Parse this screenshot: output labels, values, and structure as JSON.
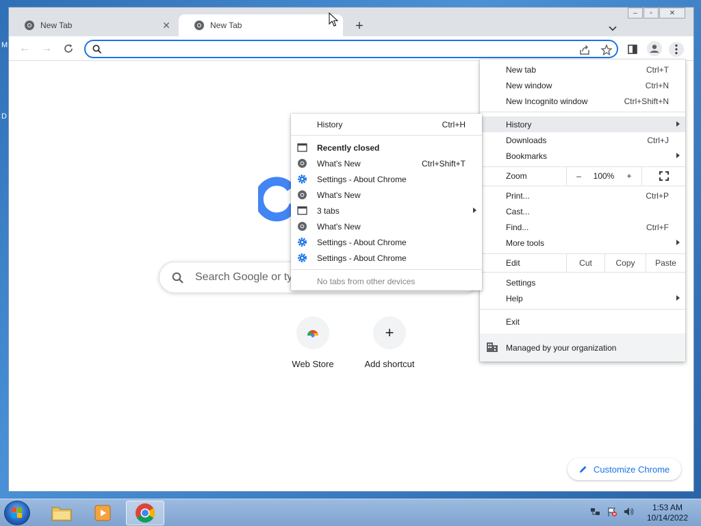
{
  "desktop": {
    "left_letters": [
      "M",
      "D"
    ]
  },
  "tabs": [
    {
      "title": "New Tab",
      "active": false
    },
    {
      "title": "New Tab",
      "active": true
    }
  ],
  "omnibox": {
    "value": "",
    "placeholder": ""
  },
  "ntp": {
    "search_placeholder": "Search Google or ty",
    "shortcuts": [
      {
        "label": "Web Store"
      },
      {
        "label": "Add shortcut"
      }
    ],
    "customize_label": "Customize Chrome"
  },
  "main_menu": {
    "new_tab": {
      "label": "New tab",
      "shortcut": "Ctrl+T"
    },
    "new_window": {
      "label": "New window",
      "shortcut": "Ctrl+N"
    },
    "new_incognito": {
      "label": "New Incognito window",
      "shortcut": "Ctrl+Shift+N"
    },
    "history": {
      "label": "History"
    },
    "downloads": {
      "label": "Downloads",
      "shortcut": "Ctrl+J"
    },
    "bookmarks": {
      "label": "Bookmarks"
    },
    "zoom": {
      "label": "Zoom",
      "minus": "–",
      "level": "100%",
      "plus": "+"
    },
    "print": {
      "label": "Print...",
      "shortcut": "Ctrl+P"
    },
    "cast": {
      "label": "Cast..."
    },
    "find": {
      "label": "Find...",
      "shortcut": "Ctrl+F"
    },
    "more_tools": {
      "label": "More tools"
    },
    "edit": {
      "label": "Edit",
      "cut": "Cut",
      "copy": "Copy",
      "paste": "Paste"
    },
    "settings": {
      "label": "Settings"
    },
    "help": {
      "label": "Help"
    },
    "exit": {
      "label": "Exit"
    },
    "managed": {
      "label": "Managed by your organization"
    }
  },
  "history_menu": {
    "history": {
      "label": "History",
      "shortcut": "Ctrl+H"
    },
    "recently_closed": "Recently closed",
    "items": [
      {
        "label": "What's New",
        "shortcut": "Ctrl+Shift+T",
        "icon": "chrome-icon"
      },
      {
        "label": "Settings - About Chrome",
        "shortcut": "",
        "icon": "gear-icon"
      },
      {
        "label": "What's New",
        "shortcut": "",
        "icon": "chrome-icon"
      },
      {
        "label": "3 tabs",
        "shortcut": "",
        "icon": "window-icon"
      },
      {
        "label": "What's New",
        "shortcut": "",
        "icon": "chrome-icon"
      },
      {
        "label": "Settings - About Chrome",
        "shortcut": "",
        "icon": "gear-icon"
      },
      {
        "label": "Settings - About Chrome",
        "shortcut": "",
        "icon": "gear-icon"
      }
    ],
    "no_tabs": "No tabs from other devices"
  },
  "taskbar": {
    "time": "1:53 AM",
    "date": "10/14/2022"
  },
  "colors": {
    "accent": "#1a73e8",
    "menu_highlight": "#e8eaed"
  }
}
